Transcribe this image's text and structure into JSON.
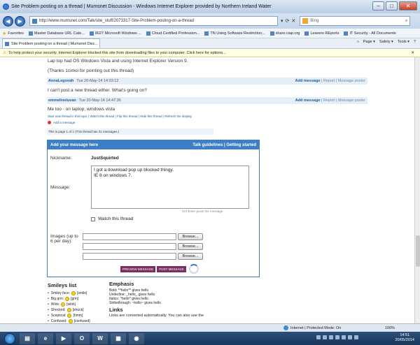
{
  "window": {
    "title": "Site Problem posting on a thread | Mumsnet Discussion - Windows Internet Explorer provided by Northern Ireland Water",
    "min": "–",
    "max": "□",
    "close": "✕"
  },
  "address": {
    "url": "http://www.mumsnet.com/Talk/site_stuff/2073317-Site-Problem-posting-on-a-thread",
    "search_engine": "Bing"
  },
  "favorites": {
    "label": "Favorites",
    "items": [
      "Master Database URL Cate...",
      "8027 Microsoft Windows ...",
      "Cloud Certified Profession...",
      "TN Using Software Restriction...",
      "share.ciap.org",
      "Leavers REports",
      "IT Security - All Documents"
    ]
  },
  "tab": {
    "label": "Site Problem posting on a thread | Mumsnet Disc..."
  },
  "command_bar": [
    "Page ▾",
    "Safety ▾",
    "Tools ▾",
    "?"
  ],
  "infobar": {
    "text": "To help protect your security, Internet Explorer blocked this site from downloading files to your computer. Click here for options..."
  },
  "thread": {
    "line1": "Lap top had OS Windows Vista and using Internet Explorer Version 9.",
    "line2": "(Thanks 1cimoi for pointing out this thread)",
    "messages": [
      {
        "author": "AnnaLegovah",
        "time": "Tue 20-May-14 14:33:12",
        "text": "I can't post a new thread either. What's going on?"
      },
      {
        "author": "emmelineluvan",
        "time": "Tue 20-May-14 14:47:36",
        "text": "Me too - on laptop, windows vista"
      }
    ],
    "msg_actions": {
      "add": "Add message",
      "rest": "| Report | Message poster"
    },
    "links": "Start new thread in this topic | Watch this thread | Flip this thread | Hide this thread | Refresh the display",
    "add_message": "Add a message",
    "page_info": "This is page 1 of 1 (This thread has 31 messages.)"
  },
  "form": {
    "header": "Add your message here",
    "guidelines": "Talk guidelines | Getting started",
    "nickname_label": "Nickname:",
    "nickname_value": "JustSquirted",
    "message_label": "Message:",
    "message_value": "I got a download pop up blocked thingy.\nIE 8 on windows 7.",
    "hint": "Ctrl-Enter posts the message",
    "watch_label": "Watch this thread",
    "images_label": "Images (up to 6 per day):",
    "browse": "Browse...",
    "preview": "PREVIEW MESSAGE",
    "post": "POST MESSAGE"
  },
  "smileys": {
    "title": "Smileys list",
    "items": [
      {
        "name": "Smiley face:",
        "code": "[smile]"
      },
      {
        "name": "Big grin:",
        "code": "[grin]"
      },
      {
        "name": "Wink:",
        "code": "[wink]"
      },
      {
        "name": "Shocked:",
        "code": "[shock]"
      },
      {
        "name": "Sceptical:",
        "code": "[hmm]"
      },
      {
        "name": "Confused:",
        "code": "[confused]"
      }
    ]
  },
  "emphasis": {
    "title": "Emphasis",
    "bold": "Bold: **hello** gives hello",
    "underline": "Underline: _hello_ gives hello",
    "italics": "Italics: ^hello^ gives hello",
    "strike": "Strikethrough: ~hello~ gives hello",
    "links_title": "Links",
    "links_text": "Links are converted automatically. You can also use the"
  },
  "status": {
    "zone": "Internet | Protected Mode: On",
    "zoom": "100%"
  },
  "taskbar": {
    "time": "14:51",
    "date": "20/05/2014"
  }
}
